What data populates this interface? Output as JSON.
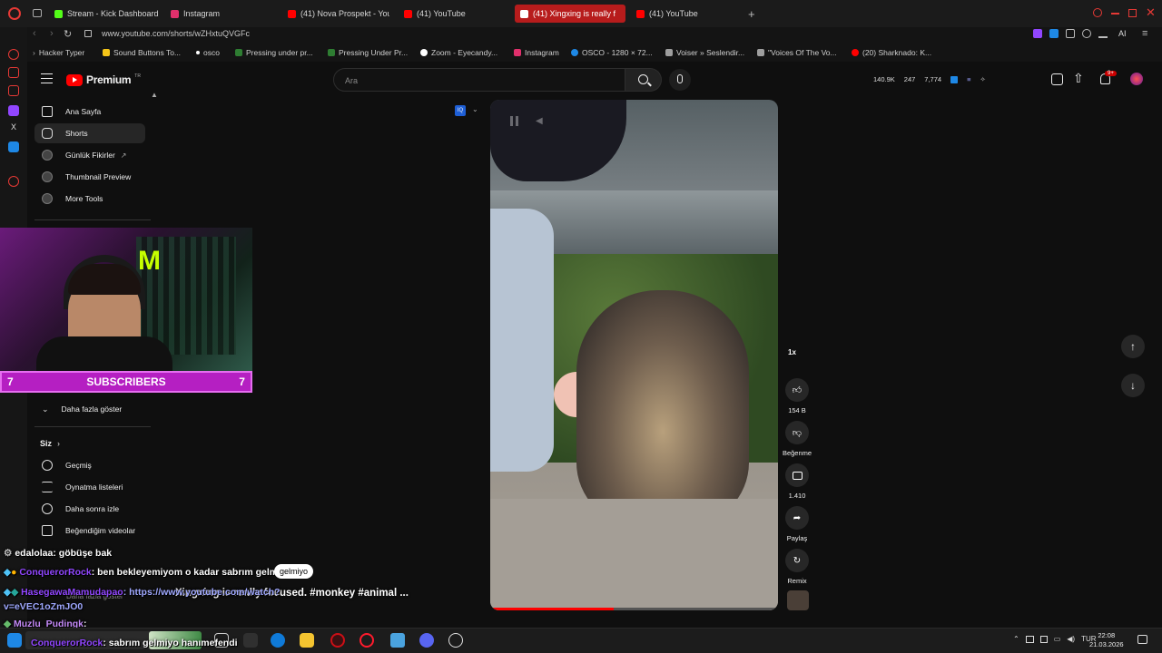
{
  "tabs": [
    {
      "label": "Stream - Kick Dashboard",
      "color": "#53fc18"
    },
    {
      "label": "Instagram",
      "color": "#e1306c"
    },
    {
      "label": "(41) Nova Prospekt - YouT",
      "color": "#ff0000"
    },
    {
      "label": "(41) YouTube",
      "color": "#ff0000"
    },
    {
      "label": "(41) Xingxing is really f",
      "color": "#ffffff"
    },
    {
      "label": "(41) YouTube",
      "color": "#ff0000"
    }
  ],
  "address": {
    "url": "www.youtube.com/shorts/wZHxtuQVGFc"
  },
  "toolbar_right": {
    "ai_label": "AI"
  },
  "bookmarks": [
    {
      "label": "Hacker Typer",
      "color": "#888"
    },
    {
      "label": "Sound Buttons To...",
      "color": "#f5c518"
    },
    {
      "label": "osco",
      "color": "#ffffff"
    },
    {
      "label": "Pressing under pr...",
      "color": "#2e7d32"
    },
    {
      "label": "Pressing Under Pr...",
      "color": "#2e7d32"
    },
    {
      "label": "Zoom - Eyecandy...",
      "color": "#ffffff"
    },
    {
      "label": "Instagram",
      "color": "#e1306c"
    },
    {
      "label": "OSCO - 1280 × 72...",
      "color": "#1e88e5"
    },
    {
      "label": "Voiser » Seslendir...",
      "color": "#9e9e9e"
    },
    {
      "label": "\"Voices Of The Vo...",
      "color": "#9e9e9e"
    },
    {
      "label": "(20) Sharknado: K...",
      "color": "#ff0000"
    }
  ],
  "header": {
    "logo_text": "Premium",
    "logo_sup": "TR",
    "search_placeholder": "Ara",
    "stats": [
      "140.9K",
      "247",
      "7,774"
    ],
    "notif_badge": "9+"
  },
  "sidebar": {
    "top_items": [
      {
        "label": "Ana Sayfa",
        "icon": "home-icon"
      },
      {
        "label": "Shorts",
        "icon": "shorts-icon",
        "active": true
      },
      {
        "label": "Günlük Fikirler",
        "icon": "circle-icon"
      },
      {
        "label": "Thumbnail Preview",
        "icon": "circle-icon"
      },
      {
        "label": "More Tools",
        "icon": "circle-icon"
      }
    ],
    "show_more": "Daha fazla göster",
    "siz_title": "Siz",
    "siz_items": [
      {
        "label": "Geçmiş",
        "icon": "history-icon"
      },
      {
        "label": "Oynatma listeleri",
        "icon": "playlist-icon"
      },
      {
        "label": "Daha sonra izle",
        "icon": "clock-icon"
      },
      {
        "label": "Beğendiğim videolar",
        "icon": "thumbs-up-icon"
      }
    ],
    "bottom_partial": "Daha fazla göster"
  },
  "webcam": {
    "subscribers_label": "SUBSCRIBERS",
    "left_count": "7",
    "right_count": "7"
  },
  "video": {
    "caption": "Xingxing is really focused. #monkey #animal ...",
    "speed": "1x"
  },
  "actions": {
    "like_count": "154 B",
    "dislike_label": "Beğenme",
    "comments_count": "1.410",
    "share_label": "Paylaş",
    "remix_label": "Remix"
  },
  "chat": [
    {
      "user": "edalolaa",
      "color": "#ffffff",
      "text": ": göbüşe bak"
    },
    {
      "user": "ConquerorRock",
      "color": "#9146ff",
      "text": ": ben bekleyemiyom o kadar sabrım gelmiyo"
    },
    {
      "user": "HasegawaMamudapao",
      "color": "#9146ff",
      "text": ": https://www.youtube.com/watch?v=eVEC1oZmJO0"
    },
    {
      "user": "Muzlu_Pudingk",
      "color": "#ffffff",
      "text": ":"
    },
    {
      "user": "ConquerorRock",
      "color": "#9146ff",
      "text": ": sabrım gelmiyo hanımefendi"
    }
  ],
  "chat_tooltip": "gelmiyo",
  "taskbar": {
    "lang": "TUR",
    "time": "22:08",
    "date": "21.03.2026"
  }
}
